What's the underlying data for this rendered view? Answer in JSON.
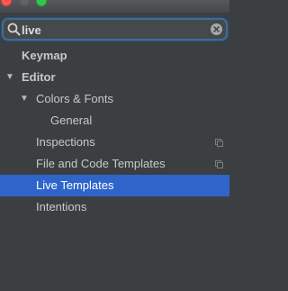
{
  "search": {
    "value": "live",
    "icon": "search-icon",
    "clear_icon": "clear-icon"
  },
  "tree": {
    "items": [
      {
        "label": "Keymap",
        "level": 0,
        "bold": true
      },
      {
        "label": "Editor",
        "level": 0,
        "bold": true,
        "expanded": true
      },
      {
        "label": "Colors & Fonts",
        "level": 1,
        "expanded": true
      },
      {
        "label": "General",
        "level": 2
      },
      {
        "label": "Inspections",
        "level": 1,
        "project_icon": true
      },
      {
        "label": "File and Code Templates",
        "level": 1,
        "project_icon": true
      },
      {
        "label": "Live Templates",
        "level": 1,
        "selected": true
      },
      {
        "label": "Intentions",
        "level": 1
      }
    ],
    "arrow_glyph": "▼"
  },
  "colors": {
    "background": "#3c3f41",
    "selection": "#2f65ca",
    "search_focus": "#3d6d99"
  }
}
